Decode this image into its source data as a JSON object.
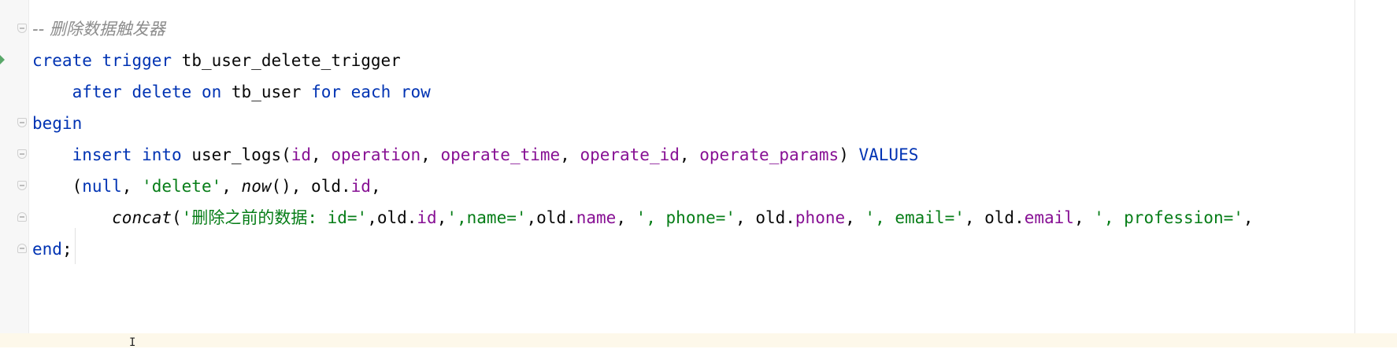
{
  "editor": {
    "lines": [
      {
        "tokens": [
          {
            "t": "-- 删除数据触发器",
            "c": "comment"
          }
        ]
      },
      {
        "tokens": [
          {
            "t": "create",
            "c": "kw"
          },
          {
            "t": " ",
            "c": "plain"
          },
          {
            "t": "trigger",
            "c": "kw"
          },
          {
            "t": " tb_user_delete_trigger",
            "c": "plain"
          }
        ]
      },
      {
        "tokens": [
          {
            "t": "    ",
            "c": "plain"
          },
          {
            "t": "after",
            "c": "kw"
          },
          {
            "t": " ",
            "c": "plain"
          },
          {
            "t": "delete",
            "c": "kw"
          },
          {
            "t": " ",
            "c": "plain"
          },
          {
            "t": "on",
            "c": "kw"
          },
          {
            "t": " tb_user ",
            "c": "plain"
          },
          {
            "t": "for",
            "c": "kw"
          },
          {
            "t": " ",
            "c": "plain"
          },
          {
            "t": "each",
            "c": "kw"
          },
          {
            "t": " ",
            "c": "plain"
          },
          {
            "t": "row",
            "c": "kw"
          }
        ]
      },
      {
        "tokens": [
          {
            "t": "begin",
            "c": "kw"
          }
        ]
      },
      {
        "tokens": [
          {
            "t": "    ",
            "c": "plain"
          },
          {
            "t": "insert",
            "c": "kw"
          },
          {
            "t": " ",
            "c": "plain"
          },
          {
            "t": "into",
            "c": "kw"
          },
          {
            "t": " user_logs(",
            "c": "plain"
          },
          {
            "t": "id",
            "c": "col"
          },
          {
            "t": ", ",
            "c": "plain"
          },
          {
            "t": "operation",
            "c": "col"
          },
          {
            "t": ", ",
            "c": "plain"
          },
          {
            "t": "operate_time",
            "c": "col"
          },
          {
            "t": ", ",
            "c": "plain"
          },
          {
            "t": "operate_id",
            "c": "col"
          },
          {
            "t": ", ",
            "c": "plain"
          },
          {
            "t": "operate_params",
            "c": "col"
          },
          {
            "t": ") ",
            "c": "plain"
          },
          {
            "t": "VALUES",
            "c": "kw"
          }
        ]
      },
      {
        "tokens": [
          {
            "t": "    (",
            "c": "plain"
          },
          {
            "t": "null",
            "c": "kw"
          },
          {
            "t": ", ",
            "c": "plain"
          },
          {
            "t": "'delete'",
            "c": "str"
          },
          {
            "t": ", ",
            "c": "plain"
          },
          {
            "t": "now",
            "c": "fn"
          },
          {
            "t": "(), old.",
            "c": "plain"
          },
          {
            "t": "id",
            "c": "col"
          },
          {
            "t": ",",
            "c": "plain"
          }
        ]
      },
      {
        "tokens": [
          {
            "t": "        ",
            "c": "plain"
          },
          {
            "t": "concat",
            "c": "fn"
          },
          {
            "t": "(",
            "c": "plain"
          },
          {
            "t": "'删除之前的数据: id='",
            "c": "str"
          },
          {
            "t": ",old.",
            "c": "plain"
          },
          {
            "t": "id",
            "c": "col"
          },
          {
            "t": ",",
            "c": "plain"
          },
          {
            "t": "',name='",
            "c": "str"
          },
          {
            "t": ",old.",
            "c": "plain"
          },
          {
            "t": "name",
            "c": "col"
          },
          {
            "t": ", ",
            "c": "plain"
          },
          {
            "t": "', phone='",
            "c": "str"
          },
          {
            "t": ", old.",
            "c": "plain"
          },
          {
            "t": "phone",
            "c": "col"
          },
          {
            "t": ", ",
            "c": "plain"
          },
          {
            "t": "', email='",
            "c": "str"
          },
          {
            "t": ", old.",
            "c": "plain"
          },
          {
            "t": "email",
            "c": "col"
          },
          {
            "t": ", ",
            "c": "plain"
          },
          {
            "t": "', profession='",
            "c": "str"
          },
          {
            "t": ", ",
            "c": "plain"
          }
        ]
      },
      {
        "tokens": [
          {
            "t": "end",
            "c": "kw"
          },
          {
            "t": ";",
            "c": "plain"
          }
        ]
      }
    ]
  },
  "colors": {
    "keyword": "#0033b3",
    "column": "#871094",
    "string": "#067d17",
    "comment": "#8c8c8c",
    "caret_line": "#fdf8ea"
  },
  "icons": [
    "fold-marker-icon",
    "run-gutter-icon",
    "text-cursor-icon"
  ]
}
